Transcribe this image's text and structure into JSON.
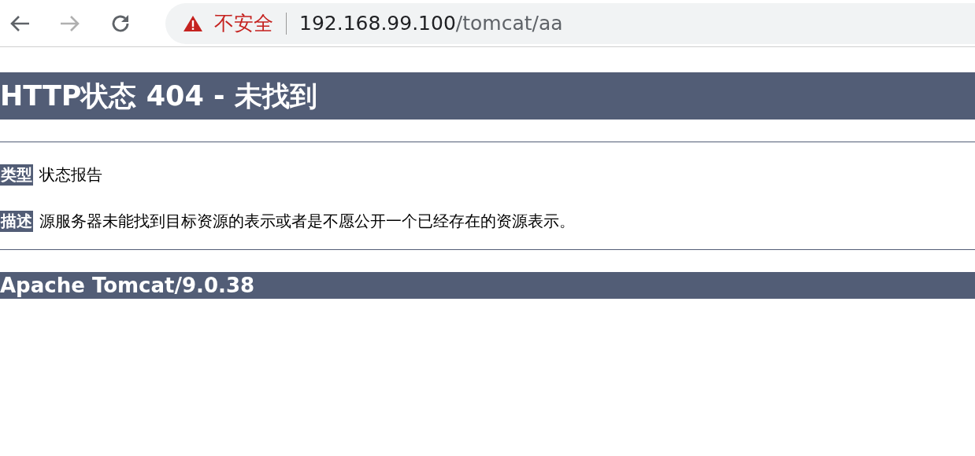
{
  "toolbar": {
    "nav_buttons": [
      {
        "kind": "back",
        "disabled": false
      },
      {
        "kind": "forward",
        "disabled": true
      },
      {
        "kind": "reload",
        "disabled": false
      }
    ],
    "address_bar": {
      "security_label": "不安全",
      "host": "192.168.99.100",
      "path": "/tomcat/aa"
    }
  },
  "page": {
    "title": "HTTP状态 404 - 未找到",
    "fields": [
      {
        "label": "类型",
        "value": "状态报告"
      },
      {
        "label": "描述",
        "value": "源服务器未能找到目标资源的表示或者是不愿公开一个已经存在的资源表示。"
      }
    ],
    "footer": "Apache Tomcat/9.0.38"
  }
}
